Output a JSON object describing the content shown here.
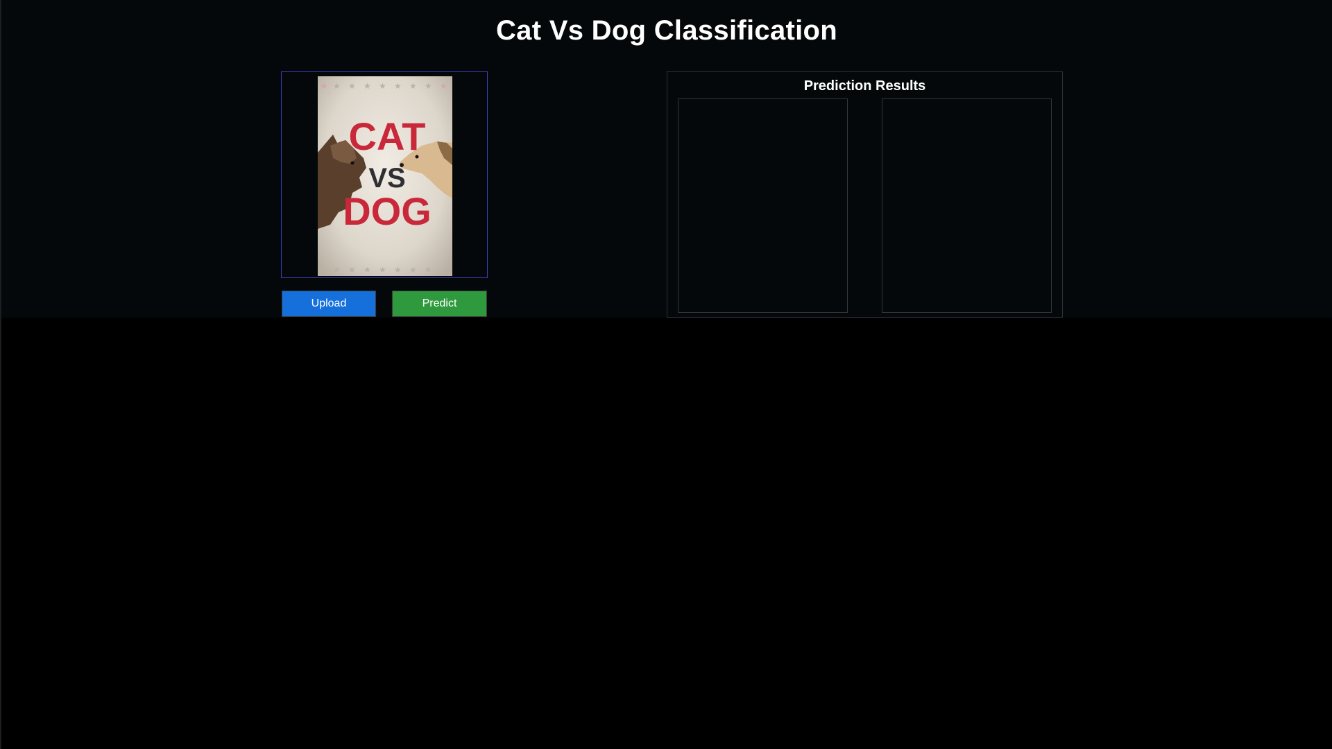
{
  "app": {
    "title": "Cat Vs Dog Classification"
  },
  "image_panel": {
    "poster": {
      "line1": "CAT",
      "line2": "VS",
      "line3": "DOG"
    }
  },
  "buttons": {
    "upload_label": "Upload",
    "predict_label": "Predict"
  },
  "results": {
    "title": "Prediction Results"
  },
  "colors": {
    "upload_button": "#1570dc",
    "predict_button": "#2e9a3d",
    "image_panel_border": "#3b3fb8",
    "poster_text_red": "#c9283a"
  }
}
